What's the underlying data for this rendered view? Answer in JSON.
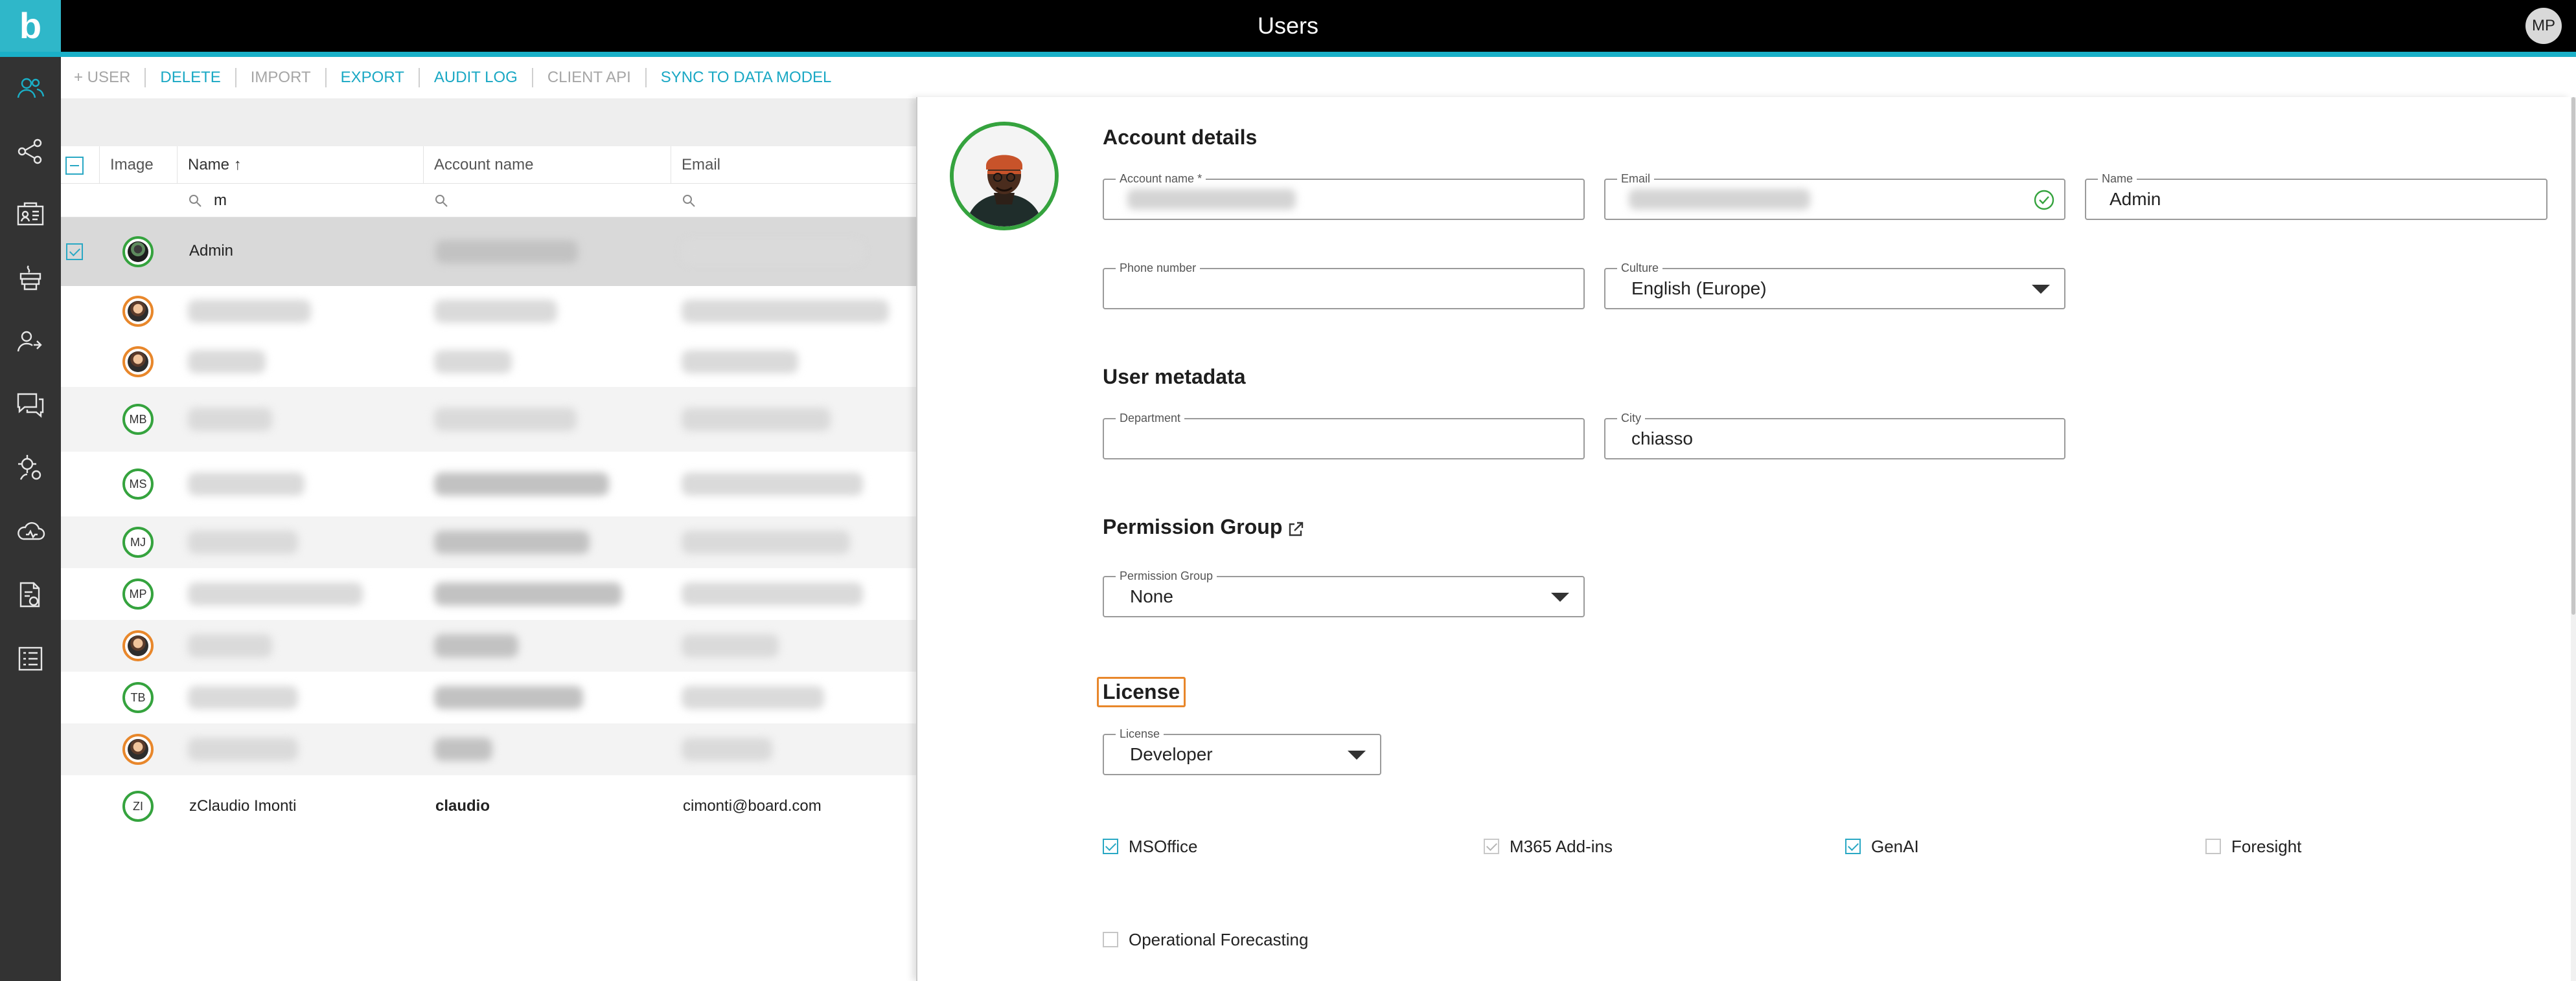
{
  "header": {
    "title": "Users",
    "user_initials": "MP",
    "logo_letter": "b"
  },
  "siderail": {
    "icons": [
      "users-icon",
      "data-model-icon",
      "presentation-icon",
      "db-icon",
      "user-group-icon",
      "chat-icon",
      "settings-flow-icon",
      "cloud-icon",
      "file-settings-icon",
      "list-icon"
    ]
  },
  "toolbar": {
    "items": [
      {
        "label": "+ USER",
        "enabled": false
      },
      {
        "label": "DELETE",
        "enabled": true
      },
      {
        "label": "IMPORT",
        "enabled": false
      },
      {
        "label": "EXPORT",
        "enabled": true
      },
      {
        "label": "AUDIT LOG",
        "enabled": true
      },
      {
        "label": "CLIENT API",
        "enabled": false
      },
      {
        "label": "SYNC TO DATA MODEL",
        "enabled": true
      }
    ]
  },
  "grid": {
    "columns": {
      "image": "Image",
      "name": "Name ↑",
      "account_name": "Account name",
      "email": "Email"
    },
    "filter": {
      "name": "m"
    },
    "rows": [
      {
        "initials": "",
        "avatar": "photo-dark",
        "name": "Admin",
        "account": "",
        "email": "",
        "selected": true
      },
      {
        "initials": "",
        "avatar": "photo",
        "name": "",
        "account": "",
        "email": ""
      },
      {
        "initials": "",
        "avatar": "photo",
        "name": "",
        "account": "",
        "email": ""
      },
      {
        "initials": "MB",
        "avatar": "green",
        "name": "",
        "account": "",
        "email": ""
      },
      {
        "initials": "MS",
        "avatar": "green",
        "name": "",
        "account": "",
        "email": ""
      },
      {
        "initials": "MJ",
        "avatar": "green",
        "name": "",
        "account": "",
        "email": ""
      },
      {
        "initials": "MP",
        "avatar": "green",
        "name": "",
        "account": "",
        "email": ""
      },
      {
        "initials": "",
        "avatar": "photo",
        "name": "",
        "account": "",
        "email": ""
      },
      {
        "initials": "TB",
        "avatar": "green",
        "name": "",
        "account": "",
        "email": ""
      },
      {
        "initials": "",
        "avatar": "photo",
        "name": "",
        "account": "",
        "email": ""
      },
      {
        "initials": "ZI",
        "avatar": "green",
        "name": "zClaudio Imonti",
        "account": "claudio",
        "email": "cimonti@board.com"
      }
    ]
  },
  "details": {
    "account_title": "Account details",
    "account_name_label": "Account name *",
    "email_label": "Email",
    "name_label": "Name",
    "name_value": "Admin",
    "phone_label": "Phone number",
    "phone_value": "",
    "culture_label": "Culture",
    "culture_value": "English (Europe)",
    "metadata_title": "User metadata",
    "department_label": "Department",
    "department_value": "",
    "city_label": "City",
    "city_value": "chiasso",
    "permission_title": "Permission Group",
    "permission_label": "Permission Group",
    "permission_value": "None",
    "license_title": "License",
    "license_label": "License",
    "license_value": "Developer",
    "checkboxes": [
      {
        "label": "MSOffice",
        "checked": true,
        "enabled": true
      },
      {
        "label": "M365 Add-ins",
        "checked": true,
        "enabled": false
      },
      {
        "label": "GenAI",
        "checked": true,
        "enabled": true
      },
      {
        "label": "Foresight",
        "checked": false,
        "enabled": true
      },
      {
        "label": "Operational Forecasting",
        "checked": false,
        "enabled": true
      }
    ]
  },
  "colors": {
    "accent": "#1ab0c8",
    "avatar_green": "#35a33e",
    "avatar_orange": "#e8872b",
    "rail": "#333333"
  }
}
